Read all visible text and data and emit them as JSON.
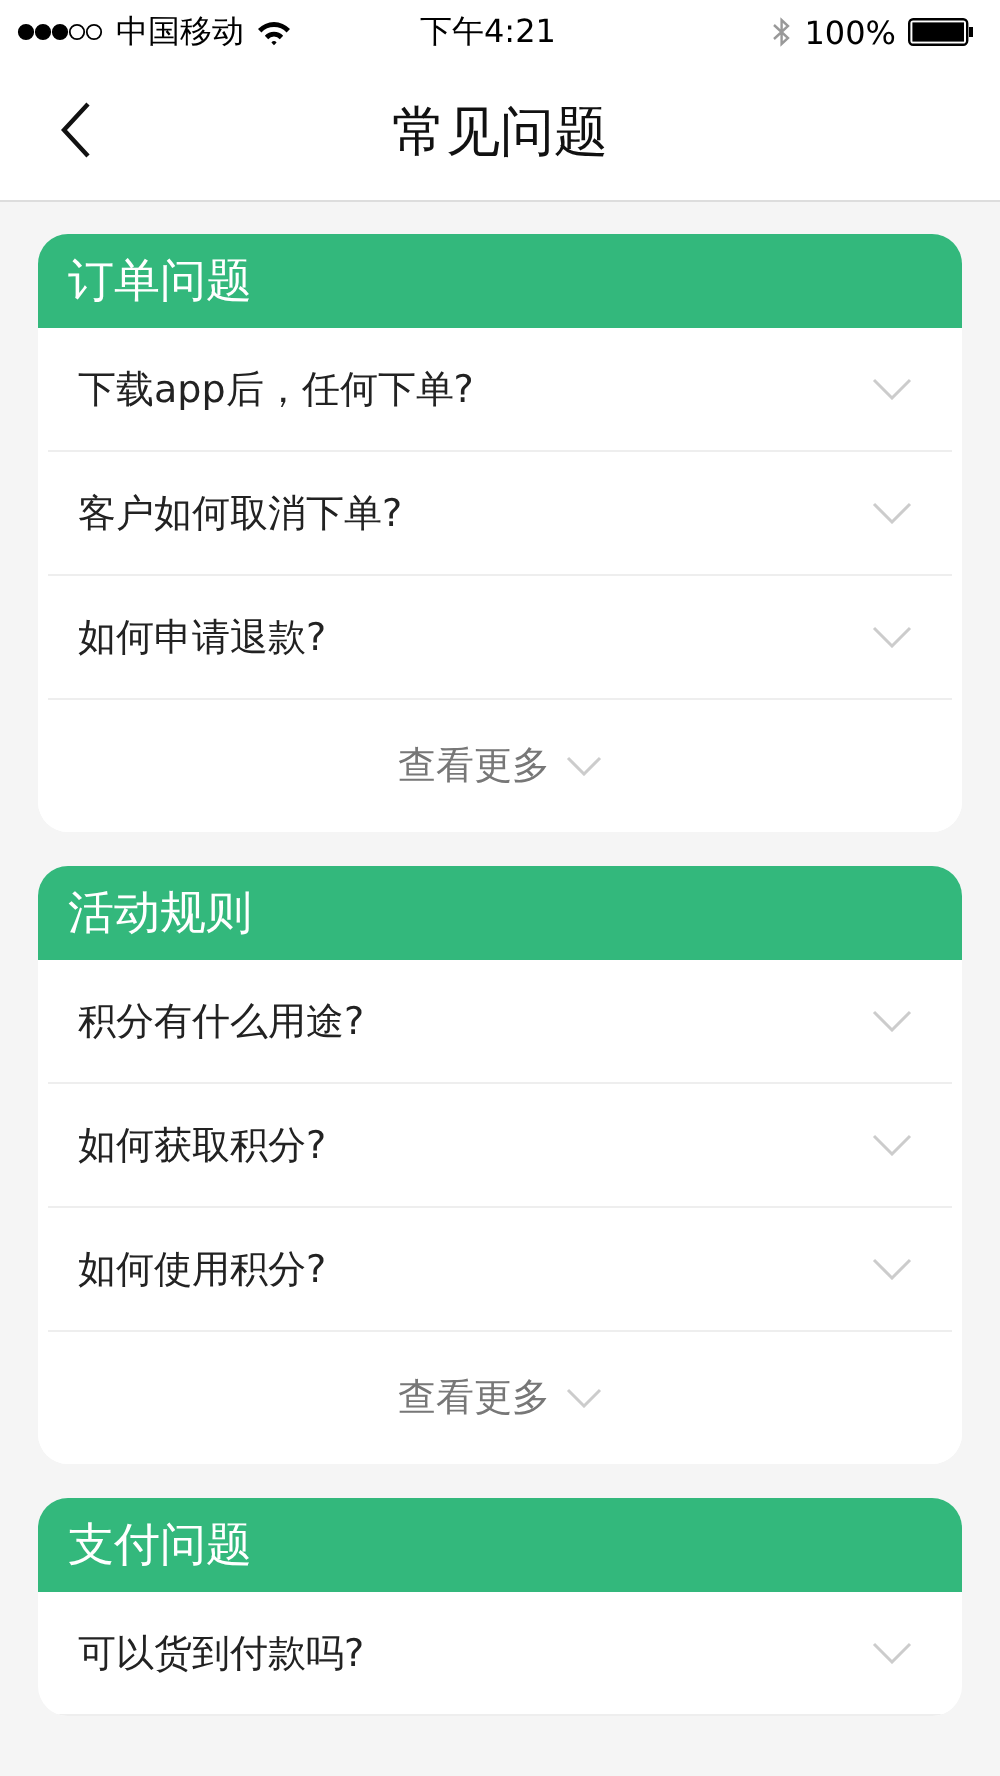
{
  "status_bar": {
    "carrier": "中国移动",
    "time": "下午4:21",
    "battery": "100%"
  },
  "nav": {
    "title": "常见问题"
  },
  "sections": [
    {
      "title": "订单问题",
      "questions": [
        "下载app后，任何下单?",
        "客户如何取消下单?",
        "如何申请退款?"
      ],
      "more": "查看更多"
    },
    {
      "title": "活动规则",
      "questions": [
        "积分有什么用途?",
        "如何获取积分?",
        "如何使用积分?"
      ],
      "more": "查看更多"
    },
    {
      "title": "支付问题",
      "questions": [
        "可以货到付款吗?"
      ]
    }
  ]
}
